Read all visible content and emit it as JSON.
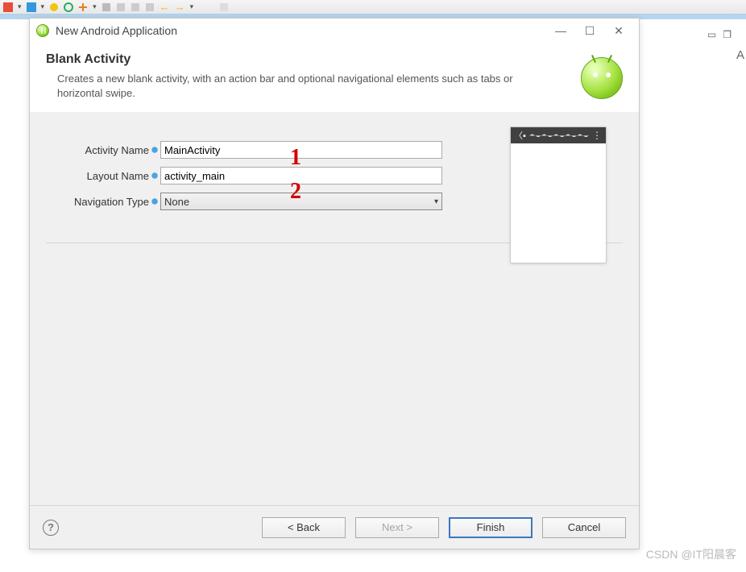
{
  "toolbar": {
    "visible": true
  },
  "dialog": {
    "title": "New Android Application",
    "header_title": "Blank Activity",
    "header_desc": "Creates a new blank activity, with an action bar and optional navigational elements such as tabs or horizontal swipe."
  },
  "form": {
    "activity_name_label": "Activity Name",
    "activity_name_value": "MainActivity",
    "layout_name_label": "Layout Name",
    "layout_name_value": "activity_main",
    "nav_type_label": "Navigation Type",
    "nav_type_value": "None"
  },
  "buttons": {
    "back": "< Back",
    "next": "Next >",
    "finish": "Finish",
    "cancel": "Cancel"
  },
  "help_glyph": "?",
  "annotations": {
    "one": "1",
    "two": "2"
  },
  "far_right_glyph": "A",
  "watermark": "CSDN @IT阳晨客"
}
